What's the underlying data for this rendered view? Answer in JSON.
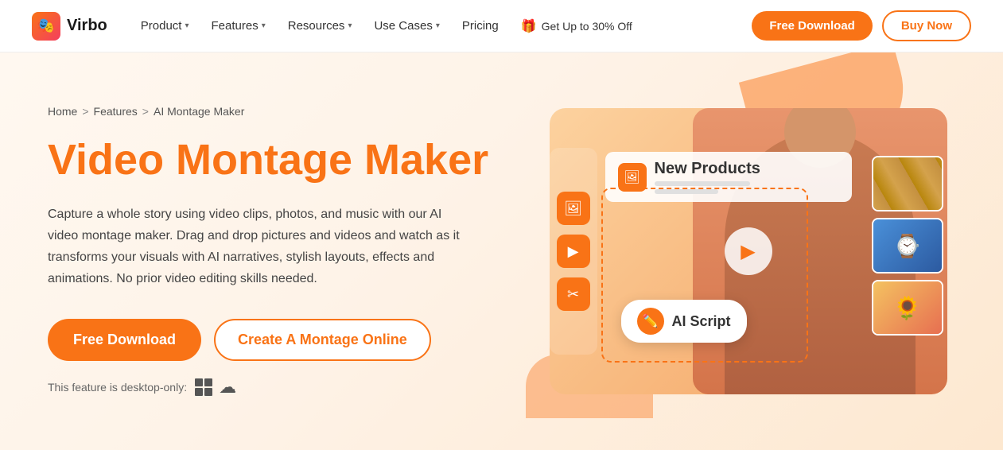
{
  "brand": {
    "name": "Virbo",
    "logo_emoji": "🎭"
  },
  "nav": {
    "items": [
      {
        "label": "Product",
        "has_dropdown": true
      },
      {
        "label": "Features",
        "has_dropdown": true
      },
      {
        "label": "Resources",
        "has_dropdown": true
      },
      {
        "label": "Use Cases",
        "has_dropdown": true
      },
      {
        "label": "Pricing",
        "has_dropdown": false
      }
    ],
    "promo": {
      "icon": "🎁",
      "label": "Get Up to 30% Off"
    },
    "cta_primary": "Free Download",
    "cta_secondary": "Buy Now"
  },
  "breadcrumb": {
    "home": "Home",
    "features": "Features",
    "current": "AI Montage Maker"
  },
  "hero": {
    "title": "Video Montage Maker",
    "description": "Capture a whole story using video clips, photos, and music with our AI video montage maker. Drag and drop pictures and videos and watch as it transforms your visuals with AI narratives, stylish layouts, effects and animations. No prior video editing skills needed.",
    "btn_primary": "Free Download",
    "btn_secondary": "Create A Montage Online",
    "desktop_label": "This feature is desktop-only:"
  },
  "illustration": {
    "banner_label": "New Products",
    "ai_script_label": "AI Script",
    "toolbar_icons": [
      "🖼",
      "▶",
      "✂"
    ]
  }
}
